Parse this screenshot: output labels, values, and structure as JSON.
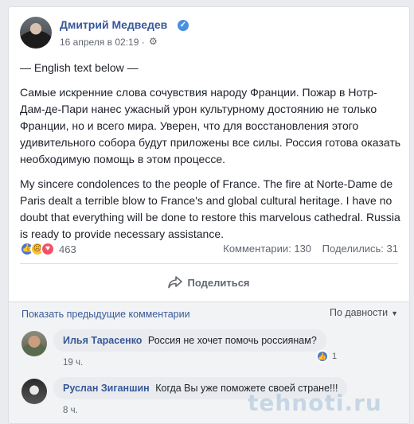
{
  "post": {
    "author": "Дмитрий Медведев",
    "date": "16 апреля в 02:19 ·",
    "paragraphs": [
      "— English text below —",
      "Самые искренние слова сочувствия народу Франции. Пожар в Нотр-Дам-де-Пари нанес ужасный урон культурному достоянию не только Франции, но и всего мира. Уверен, что для восстановления этого удивительного собора будут приложены все силы. Россия готова оказать необходимую помощь в этом процессе.",
      "My sincere condolences to the people of France. The fire at Norte-Dame de Paris dealt a terrible blow to France's and global cultural heritage. I have no doubt that everything will be done to restore this marvelous cathedral. Russia is ready to provide necessary assistance."
    ],
    "reaction_count": "463",
    "comments_stat": "Комментарии: 130",
    "shares_stat": "Поделились: 31",
    "share_label": "Поделиться"
  },
  "comments": {
    "show_previous": "Показать предыдущие комментарии",
    "sort_label": "По давности",
    "items": [
      {
        "name": "Илья Тарасенко",
        "text": "Россия не хочет помочь россиянам?",
        "time": "19 ч.",
        "likes": "1"
      },
      {
        "name": "Руслан Зиганшин",
        "text": "Когда Вы уже поможете своей стране!!!",
        "time": "8 ч."
      }
    ]
  },
  "watermark": "tehnoti.ru",
  "icons": {
    "verified": "verified-badge-icon",
    "audience": "gear-icon",
    "share": "share-arrow-icon",
    "sort": "caret-down-icon"
  },
  "colors": {
    "link": "#385898",
    "author": "#365899",
    "like": "#4a76d1",
    "love": "#f25268",
    "sad": "#f5c33b"
  }
}
